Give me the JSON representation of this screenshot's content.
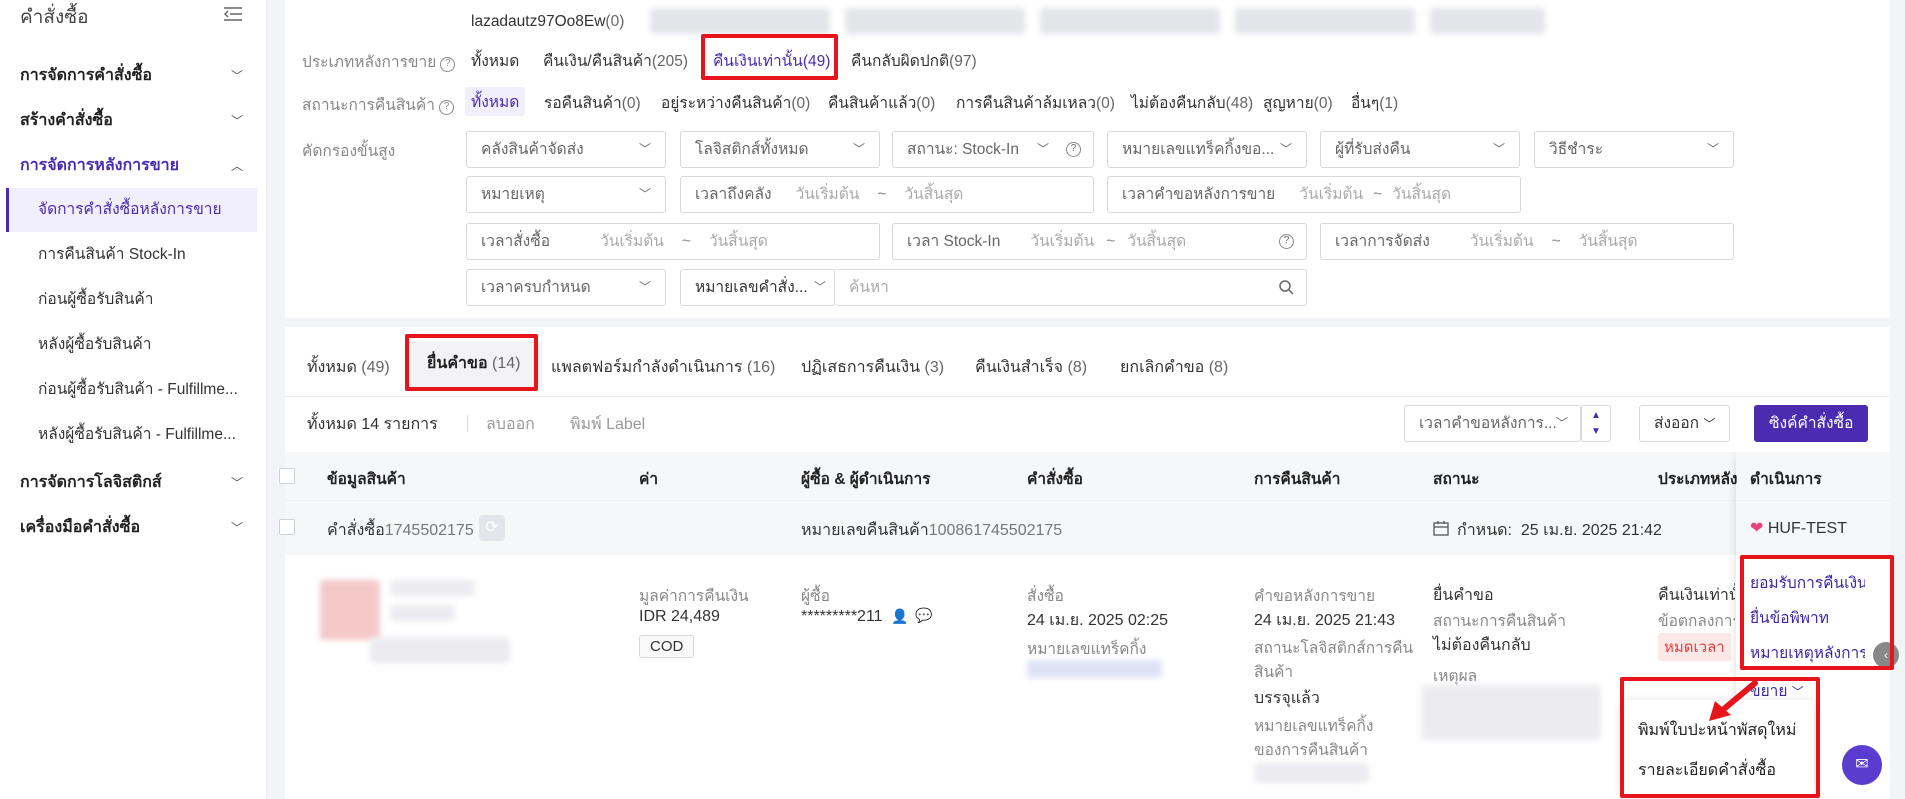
{
  "sidebar": {
    "title": "คำสั่งซื้อ",
    "groups": [
      {
        "label": "การจัดการคำสั่งซื้อ"
      },
      {
        "label": "สร้างคำสั่งซื้อ"
      },
      {
        "label": "การจัดการหลังการขาย"
      },
      {
        "label": "การจัดการโลจิสติกส์"
      },
      {
        "label": "เครื่องมือคำสั่งซื้อ"
      }
    ],
    "items": [
      {
        "label": "จัดการคำสั่งซื้อหลังการขาย"
      },
      {
        "label": "การคืนสินค้า Stock-In"
      },
      {
        "label": "ก่อนผู้ซื้อรับสินค้า"
      },
      {
        "label": "หลังผู้ซื้อรับสินค้า"
      },
      {
        "label": "ก่อนผู้ซื้อรับสินค้า - Fulfillme..."
      },
      {
        "label": "หลังผู้ซื้อรับสินค้า - Fulfillme..."
      }
    ]
  },
  "filters": {
    "store": {
      "name": "lazadautz97Oo8Ew",
      "count": "(0)"
    },
    "sale_type": {
      "label": "ประเภทหลังการขาย",
      "options": [
        {
          "label": "ทั้งหมด",
          "count": ""
        },
        {
          "label": "คืนเงิน/คืนสินค้า",
          "count": "(205)"
        },
        {
          "label": "คืนเงินเท่านั้น",
          "count": "(49)"
        },
        {
          "label": "คืนกลับผิดปกติ",
          "count": "(97)"
        }
      ]
    },
    "return_status": {
      "label": "สถานะการคืนสินค้า",
      "options": [
        {
          "label": "ทั้งหมด",
          "count": ""
        },
        {
          "label": "รอคืนสินค้า",
          "count": "(0)"
        },
        {
          "label": "อยู่ระหว่างคืนสินค้า",
          "count": "(0)"
        },
        {
          "label": "คืนสินค้าแล้ว",
          "count": "(0)"
        },
        {
          "label": "การคืนสินค้าล้มเหลว",
          "count": "(0)"
        },
        {
          "label": "ไม่ต้องคืนกลับ",
          "count": "(48)"
        },
        {
          "label": "สูญหาย",
          "count": "(0)"
        },
        {
          "label": "อื่นๆ",
          "count": "(1)"
        }
      ]
    },
    "advanced": {
      "label": "คัดกรองขั้นสูง",
      "warehouse": "คลังสินค้าจัดส่ง",
      "logistics": "โลจิสติกส์ทั้งหมด",
      "stockin_status": "สถานะ: Stock-In",
      "tracking": "หมายเลขแทร็คกิ้งขอ...",
      "return_receiver": "ผู้ที่รับส่งคืน",
      "payment": "วิธีชำระ",
      "reason": "หมายเหตุ",
      "arrive_time": "เวลาถึงคลัง",
      "request_time": "เวลาคำขอหลังการขาย",
      "order_time": "เวลาสั่งซื้อ",
      "stockin_time": "เวลา Stock-In",
      "ship_time": "เวลาการจัดส่ง",
      "due_time": "เวลาครบกำหนด",
      "order_no": "หมายเลขคำสั่ง...",
      "search_placeholder": "ค้นหา",
      "start_date": "วันเริ่มต้น",
      "end_date": "วันสิ้นสุด",
      "tilde": "~"
    }
  },
  "tabs": [
    {
      "label": "ทั้งหมด",
      "count": "(49)"
    },
    {
      "label": "ยื่นคำขอ",
      "count": "(14)"
    },
    {
      "label": "แพลตฟอร์มกำลังดำเนินการ",
      "count": "(16)"
    },
    {
      "label": "ปฏิเสธการคืนเงิน",
      "count": "(3)"
    },
    {
      "label": "คืนเงินสำเร็จ",
      "count": "(8)"
    },
    {
      "label": "ยกเลิกคำขอ",
      "count": "(8)"
    }
  ],
  "toolbar": {
    "total": "ทั้งหมด 14 รายการ",
    "delete": "ลบออก",
    "print_label": "พิมพ์ Label",
    "sort": "เวลาคำขอหลังการ...",
    "export": "ส่งออก",
    "sync": "ซิงค์คำสั่งซื้อ"
  },
  "table": {
    "headers": [
      "ข้อมูลสินค้า",
      "ค่า",
      "ผู้ซื้อ & ผู้ดำเนินการ",
      "คำสั่งซื้อ",
      "การคืนสินค้า",
      "สถานะ",
      "ประเภทหลัง",
      "ดำเนินการ"
    ]
  },
  "order": {
    "order_label": "คำสั่งซื้อ",
    "order_no": "1745502175",
    "return_label": "หมายเลขคืนสินค้า",
    "return_no": "100861745502175",
    "due_label": "กำหนด:",
    "due_time": "25 เม.ย. 2025 21:42",
    "store": "HUF-TEST",
    "refund_label": "มูลค่าการคืนเงิน",
    "refund_value": "IDR 24,489",
    "payment_tag": "COD",
    "buyer_label": "ผู้ซื้อ",
    "buyer_value": "*********211",
    "ordered_label": "สั่งซื้อ",
    "ordered_time": "24 เม.ย. 2025 02:25",
    "tracking_label": "หมายเลขแทร็คกิ้ง",
    "request_label": "คำขอหลังการขาย",
    "request_time": "24 เม.ย. 2025 21:43",
    "logistics_label": "สถานะโลจิสติกส์การคืนสินค้า",
    "logistics_value": "บรรจุแล้ว",
    "return_tracking_label": "หมายเลขแทร็คกิ้งของการคืนสินค้า",
    "status_value": "ยื่นคำขอ",
    "status_sub_label": "สถานะการคืนสินค้า",
    "status_sub_value": "ไม่ต้องคืนกลับ",
    "reason_label": "เหตุผล",
    "type_value": "คืนเงินเท่านั้น",
    "type_sub": "ข้อตกลงการ",
    "timeout": "หมดเวลา",
    "actions": [
      "ยอมรับการคืนเงิน",
      "ยื่นข้อพิพาท",
      "หมายเหตุหลังการขาย"
    ],
    "expand": "ขยาย",
    "dropdown": [
      "พิมพ์ใบปะหน้าพัสดุใหม่",
      "รายละเอียดคำสั่งซื้อ"
    ]
  },
  "colors": {
    "accent": "#4b2bb0",
    "highlight": "#e8141b",
    "danger": "#e23b3b"
  }
}
